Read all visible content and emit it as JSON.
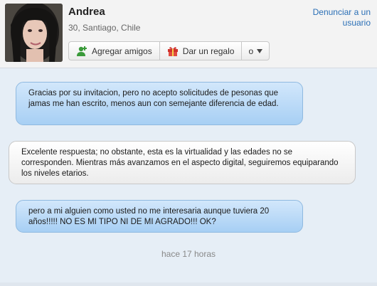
{
  "profile": {
    "name": "Andrea",
    "location": "30, Santiago, Chile",
    "report_link": "Denunciar a un usuario"
  },
  "actions": {
    "add_friends": "Agregar amigos",
    "gift": "Dar un regalo",
    "menu": "o"
  },
  "icons": {
    "add_friends": "add-user-icon",
    "gift": "gift-icon",
    "menu": "dropdown-arrow-icon"
  },
  "messages": [
    {
      "text": "Gracias por su invitacion, pero no acepto solicitudes de pesonas que jamas me han escrito, menos aun con semejante diferencia de edad.",
      "sender": "other"
    },
    {
      "text": "Excelente respuesta; no obstante, esta es la virtualidad y las edades no se corresponden. Mientras más avanzamos en el aspecto digital, seguiremos equiparando los niveles etarios.",
      "sender": "self"
    },
    {
      "text": "pero a mi alguien como usted no me interesaria aunque tuviera 20 años!!!!! NO ES MI TIPO NI DE MI AGRADO!!! OK?",
      "sender": "other"
    }
  ],
  "timestamp": "hace 17 horas",
  "colors": {
    "link": "#2a6fb6",
    "bubble_other": "#b9daf7",
    "bubble_self": "#f4f4f4",
    "page_bg": "#e6eef6"
  }
}
